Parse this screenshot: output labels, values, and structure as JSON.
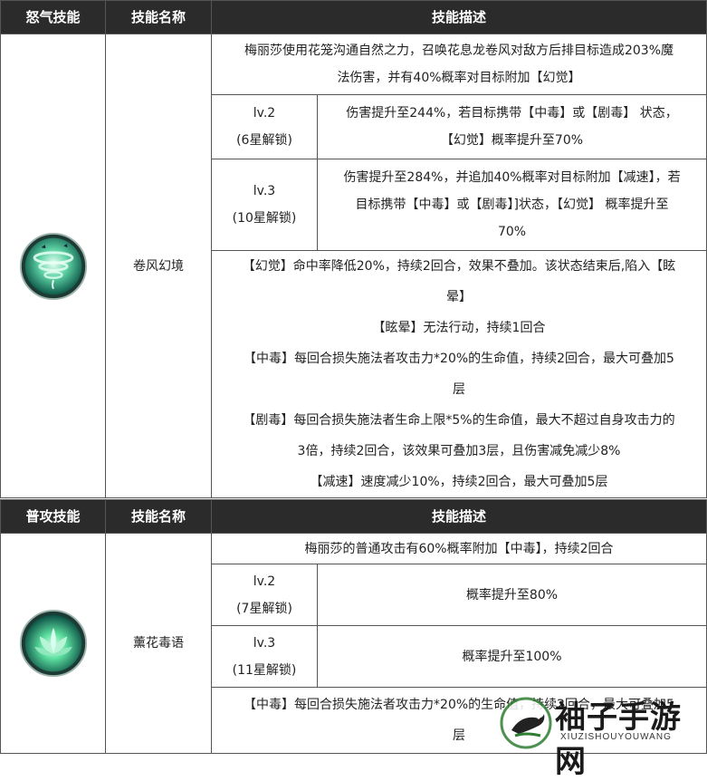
{
  "section1": {
    "headers": [
      "怒气技能",
      "技能名称",
      "技能描述"
    ],
    "skill_name": "卷风幻境",
    "icon": "tornado-skill-icon",
    "main_desc_line1": "梅丽莎使用花笼沟通自然之力，召唤花息龙卷风对敌方后排目标造成203%魔",
    "main_desc_line2": "法伤害，并有40%概率对目标附加【幻觉】",
    "lv2_level": "lv.2",
    "lv2_unlock": "(6星解锁)",
    "lv2_desc_line1": "伤害提升至244%，若目标携带【中毒】或【剧毒】 状态，",
    "lv2_desc_line2": "【幻觉】概率提升至70%",
    "lv3_level": "lv.3",
    "lv3_unlock": "(10星解锁)",
    "lv3_desc_line1": "伤害提升至284%，并追加40%概率对目标附加【减速】，若",
    "lv3_desc_line2": "目标携带【中毒】或【剧毒】]状态，【幻觉】 概率提升至",
    "lv3_desc_line3": "70%",
    "notes": [
      "【幻觉】命中率降低20%，持续2回合，效果不叠加。该状态结束后,陷入【眩",
      "晕】",
      "【眩晕】无法行动，持续1回合",
      "【中毒】每回合损失施法者攻击力*20%的生命值，持续2回合，最大可叠加5",
      "层",
      "【剧毒】每回合损失施法者生命上限*5%的生命值，最大不超过自身攻击力的",
      "3倍，持续2回合，该效果可叠加3层，且伤害减免减少8%",
      "【减速】速度减少10%，持续2回合，最大可叠加5层"
    ]
  },
  "section2": {
    "headers": [
      "普攻技能",
      "技能名称",
      "技能描述"
    ],
    "skill_name": "薰花毒语",
    "icon": "lotus-skill-icon",
    "main_desc": "梅丽莎的普通攻击有60%概率附加【中毒】，持续2回合",
    "lv2_level": "lv.2",
    "lv2_unlock": "(7星解锁)",
    "lv2_desc": "概率提升至80%",
    "lv3_level": "lv.3",
    "lv3_unlock": "(11星解锁)",
    "lv3_desc": "概率提升至100%",
    "note_line1": "【中毒】每回合损失施法者攻击力*20%的生命值，持续2回合，最大可叠加5",
    "note_line2": "层"
  },
  "watermark": {
    "title": "袖子手游网",
    "subtitle": "XIUZISHOUYOUWANG",
    "icon": "bird-logo-icon"
  }
}
